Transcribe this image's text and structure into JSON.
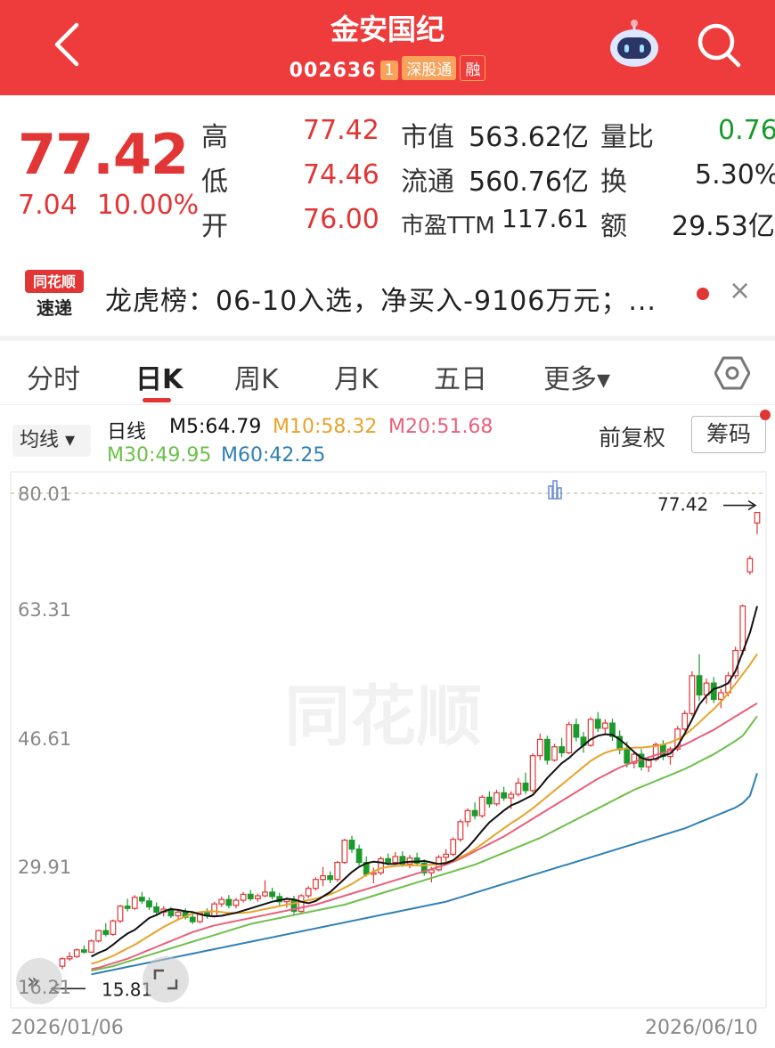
{
  "header": {
    "title": "金安国纪",
    "code": "002636",
    "badge_small": "1",
    "badge_market": "深股通",
    "badge_extra": "融"
  },
  "quote": {
    "price": "77.42",
    "change": "7.04",
    "change_pct": "10.00%",
    "high_label": "高",
    "high_value": "77.42",
    "low_label": "低",
    "low_value": "74.46",
    "open_label": "开",
    "open_value": "76.00",
    "mcap_label": "市值",
    "mcap_value": "563.62亿",
    "float_label": "流通",
    "float_value": "560.76亿",
    "pe_label": "市盈TTM",
    "pe_value": "117.61",
    "volratio_label": "量比",
    "volratio_value": "0.76",
    "turnover_label": "换",
    "turnover_value": "5.30%",
    "amount_label": "额",
    "amount_value": "29.53亿"
  },
  "news": {
    "logo_top": "同花顺",
    "logo_bottom": "速递",
    "text": "龙虎榜：06-10入选，净买入-9106万元；...",
    "close": "×"
  },
  "tabs": [
    "分时",
    "日K",
    "周K",
    "月K",
    "五日",
    "更多▾"
  ],
  "indicators": {
    "button": "均线 ▾",
    "line_label": "日线",
    "ma5": "M5:64.79",
    "ma10": "M10:58.32",
    "ma20": "M20:51.68",
    "ma30": "M30:49.95",
    "ma60": "M60:42.25",
    "adjust": "前复权",
    "chips": "筹码"
  },
  "colors": {
    "red": "#e23535",
    "green": "#1a9a2a",
    "ma5": "#111111",
    "ma10": "#e8a32a",
    "ma20": "#e8607a",
    "ma30": "#6cc04a",
    "ma60": "#2f7fb5"
  },
  "chart_data": {
    "type": "candlestick",
    "y_ticks": [
      "80.01",
      "63.31",
      "46.61",
      "29.91",
      "16.21"
    ],
    "ylim": [
      13.21,
      80.01
    ],
    "x_labels": [
      "2026/01/06",
      "2026/06/10"
    ],
    "annotations": {
      "high": "77.42",
      "low": "15.81"
    },
    "ohlc": [
      [
        16.2,
        17.4,
        15.81,
        17.2
      ],
      [
        17.2,
        18.1,
        16.9,
        17.5
      ],
      [
        17.5,
        18.6,
        17.3,
        18.4
      ],
      [
        18.4,
        19.0,
        17.9,
        18.1
      ],
      [
        18.1,
        19.8,
        18.0,
        19.6
      ],
      [
        19.6,
        21.1,
        19.4,
        21.0
      ],
      [
        21.0,
        22.0,
        20.2,
        20.5
      ],
      [
        20.5,
        22.5,
        20.3,
        22.3
      ],
      [
        22.3,
        24.5,
        22.0,
        24.3
      ],
      [
        24.3,
        25.3,
        23.6,
        24.0
      ],
      [
        24.0,
        25.8,
        23.8,
        25.5
      ],
      [
        25.5,
        26.2,
        24.6,
        25.0
      ],
      [
        25.0,
        25.5,
        23.8,
        24.2
      ],
      [
        24.2,
        24.8,
        23.2,
        23.5
      ],
      [
        23.5,
        24.3,
        22.9,
        23.9
      ],
      [
        23.9,
        24.2,
        22.7,
        23.0
      ],
      [
        23.0,
        23.8,
        22.4,
        23.5
      ],
      [
        23.5,
        24.0,
        22.5,
        22.8
      ],
      [
        22.8,
        23.4,
        21.9,
        22.2
      ],
      [
        22.2,
        23.6,
        22.0,
        23.4
      ],
      [
        23.4,
        24.0,
        22.6,
        23.0
      ],
      [
        23.0,
        24.9,
        22.8,
        24.6
      ],
      [
        24.6,
        25.6,
        24.2,
        25.2
      ],
      [
        25.2,
        25.8,
        24.0,
        24.4
      ],
      [
        24.4,
        25.4,
        24.0,
        25.1
      ],
      [
        25.1,
        26.2,
        24.8,
        25.9
      ],
      [
        25.9,
        26.5,
        25.0,
        25.3
      ],
      [
        25.3,
        26.0,
        24.9,
        25.7
      ],
      [
        25.7,
        27.8,
        25.5,
        26.2
      ],
      [
        26.2,
        26.8,
        25.2,
        25.6
      ],
      [
        25.6,
        26.1,
        24.4,
        24.9
      ],
      [
        24.9,
        25.5,
        24.1,
        25.2
      ],
      [
        25.2,
        25.7,
        23.0,
        23.6
      ],
      [
        23.6,
        25.9,
        23.4,
        25.7
      ],
      [
        25.7,
        27.0,
        25.4,
        26.7
      ],
      [
        26.7,
        28.2,
        26.4,
        27.9
      ],
      [
        27.9,
        29.6,
        27.0,
        28.4
      ],
      [
        28.4,
        29.0,
        27.4,
        27.9
      ],
      [
        27.9,
        30.4,
        27.6,
        30.2
      ],
      [
        30.2,
        33.4,
        30.0,
        33.2
      ],
      [
        33.2,
        33.8,
        31.5,
        32.0
      ],
      [
        32.0,
        32.6,
        29.8,
        30.2
      ],
      [
        30.2,
        31.0,
        28.3,
        28.6
      ],
      [
        28.6,
        29.5,
        27.4,
        28.8
      ],
      [
        28.8,
        31.0,
        28.5,
        30.7
      ],
      [
        30.7,
        31.4,
        29.8,
        30.2
      ],
      [
        30.2,
        31.6,
        29.9,
        31.0
      ],
      [
        31.0,
        31.7,
        29.6,
        30.0
      ],
      [
        30.0,
        31.2,
        29.4,
        30.8
      ],
      [
        30.8,
        31.5,
        29.8,
        30.1
      ],
      [
        30.1,
        30.6,
        28.4,
        28.8
      ],
      [
        28.8,
        29.6,
        27.5,
        29.2
      ],
      [
        29.2,
        31.2,
        29.0,
        30.9
      ],
      [
        30.9,
        32.0,
        30.3,
        31.3
      ],
      [
        31.3,
        33.6,
        31.0,
        33.3
      ],
      [
        33.3,
        36.0,
        33.0,
        35.7
      ],
      [
        35.7,
        37.5,
        35.0,
        37.2
      ],
      [
        37.2,
        38.3,
        36.0,
        36.5
      ],
      [
        36.5,
        39.3,
        36.2,
        39.0
      ],
      [
        39.0,
        39.8,
        37.6,
        38.1
      ],
      [
        38.1,
        40.0,
        37.8,
        39.6
      ],
      [
        39.6,
        40.4,
        38.5,
        38.9
      ],
      [
        38.9,
        39.8,
        37.4,
        39.4
      ],
      [
        39.4,
        41.6,
        39.1,
        40.9
      ],
      [
        40.9,
        42.3,
        39.4,
        39.9
      ],
      [
        39.9,
        44.9,
        39.6,
        44.6
      ],
      [
        44.6,
        47.6,
        44.0,
        46.8
      ],
      [
        46.8,
        47.3,
        43.4,
        44.0
      ],
      [
        44.0,
        46.2,
        43.8,
        45.8
      ],
      [
        45.8,
        47.0,
        44.4,
        45.0
      ],
      [
        45.0,
        49.2,
        44.8,
        48.8
      ],
      [
        48.8,
        49.6,
        46.5,
        47.1
      ],
      [
        47.1,
        47.8,
        45.0,
        46.0
      ],
      [
        46.0,
        49.8,
        45.8,
        49.5
      ],
      [
        49.5,
        50.5,
        47.8,
        48.3
      ],
      [
        48.3,
        49.5,
        47.4,
        49.0
      ],
      [
        49.0,
        49.6,
        46.6,
        47.2
      ],
      [
        47.2,
        48.0,
        44.8,
        45.4
      ],
      [
        45.4,
        46.5,
        43.0,
        43.6
      ],
      [
        43.6,
        45.2,
        42.9,
        44.8
      ],
      [
        44.8,
        45.5,
        42.6,
        43.1
      ],
      [
        43.1,
        44.5,
        42.4,
        44.1
      ],
      [
        44.1,
        46.4,
        43.8,
        46.1
      ],
      [
        46.1,
        46.7,
        44.0,
        44.5
      ],
      [
        44.5,
        45.8,
        43.4,
        45.5
      ],
      [
        45.5,
        48.6,
        45.2,
        48.2
      ],
      [
        48.2,
        50.7,
        47.9,
        50.3
      ],
      [
        50.3,
        56.0,
        50.0,
        55.4
      ],
      [
        55.4,
        58.3,
        52.0,
        52.8
      ],
      [
        52.8,
        55.0,
        51.6,
        54.4
      ],
      [
        54.4,
        55.2,
        51.7,
        52.2
      ],
      [
        52.2,
        53.6,
        51.0,
        53.1
      ],
      [
        53.1,
        55.9,
        52.6,
        55.4
      ],
      [
        55.4,
        59.3,
        55.0,
        58.8
      ],
      [
        58.8,
        65.0,
        58.2,
        64.8
      ],
      [
        69.4,
        71.6,
        69.0,
        71.2
      ],
      [
        76.0,
        77.42,
        74.46,
        77.42
      ]
    ],
    "ma": {
      "M5": [
        17.5,
        18.0,
        18.4,
        19.1,
        19.9,
        20.6,
        21.1,
        21.9,
        22.7,
        23.1,
        23.6,
        23.9,
        23.8,
        23.6,
        23.5,
        23.2,
        23.0,
        22.9,
        23.0,
        23.2,
        23.4,
        23.7,
        24.0,
        24.3,
        24.6,
        24.9,
        25.1,
        25.3,
        25.2,
        24.9,
        24.7,
        25.0,
        25.6,
        26.2,
        27.1,
        28.0,
        28.9,
        29.6,
        30.1,
        30.3,
        30.2,
        30.0,
        30.0,
        30.2,
        30.3,
        30.3,
        30.4,
        30.2,
        30.0,
        30.1,
        30.5,
        31.3,
        32.2,
        33.3,
        34.5,
        35.6,
        36.4,
        37.2,
        37.9,
        38.3,
        38.8,
        39.3,
        40.4,
        41.6,
        42.6,
        43.6,
        44.3,
        45.2,
        46.0,
        46.8,
        47.3,
        47.5,
        47.4,
        46.8,
        46.0,
        45.1,
        44.3,
        44.0,
        44.2,
        44.6,
        44.9,
        45.9,
        47.6,
        49.5,
        51.5,
        52.7,
        53.6,
        53.9,
        54.4,
        56.0,
        58.6,
        61.2,
        64.79
      ],
      "M10": [
        16.5,
        16.8,
        17.2,
        17.6,
        18.1,
        18.6,
        19.1,
        19.7,
        20.3,
        20.9,
        21.5,
        22.0,
        22.5,
        22.9,
        23.3,
        23.5,
        23.6,
        23.6,
        23.5,
        23.4,
        23.4,
        23.4,
        23.5,
        23.7,
        23.9,
        24.1,
        24.3,
        24.5,
        24.7,
        24.9,
        25.1,
        25.3,
        25.6,
        25.9,
        26.3,
        26.8,
        27.3,
        27.9,
        28.5,
        29.0,
        29.4,
        29.6,
        29.7,
        29.8,
        29.8,
        29.8,
        29.8,
        29.9,
        30.0,
        30.2,
        30.5,
        30.9,
        31.4,
        32.0,
        32.7,
        33.4,
        34.1,
        34.8,
        35.5,
        36.1,
        36.8,
        37.5,
        38.3,
        39.1,
        39.9,
        40.7,
        41.5,
        42.3,
        43.1,
        43.9,
        44.5,
        45.0,
        45.3,
        45.5,
        45.6,
        45.7,
        45.7,
        45.8,
        45.9,
        46.1,
        46.4,
        46.8,
        47.4,
        48.2,
        49.1,
        50.0,
        50.9,
        51.9,
        53.0,
        54.3,
        55.6,
        56.9,
        58.32
      ],
      "M20": [
        15.8,
        16.0,
        16.3,
        16.6,
        16.9,
        17.2,
        17.6,
        18.0,
        18.4,
        18.8,
        19.2,
        19.6,
        20.0,
        20.4,
        20.8,
        21.1,
        21.4,
        21.7,
        21.9,
        22.1,
        22.3,
        22.5,
        22.7,
        22.9,
        23.1,
        23.3,
        23.5,
        23.7,
        23.9,
        24.1,
        24.3,
        24.5,
        24.8,
        25.1,
        25.4,
        25.7,
        26.0,
        26.3,
        26.6,
        26.9,
        27.2,
        27.5,
        27.8,
        28.1,
        28.4,
        28.7,
        29.0,
        29.3,
        29.6,
        29.9,
        30.3,
        30.7,
        31.2,
        31.7,
        32.2,
        32.7,
        33.2,
        33.7,
        34.3,
        34.9,
        35.5,
        36.1,
        36.7,
        37.3,
        37.9,
        38.5,
        39.1,
        39.7,
        40.3,
        40.9,
        41.5,
        42.0,
        42.5,
        43.0,
        43.4,
        43.8,
        44.1,
        44.4,
        44.7,
        45.0,
        45.3,
        45.7,
        46.1,
        46.6,
        47.1,
        47.6,
        48.1,
        48.7,
        49.3,
        49.9,
        50.5,
        51.1,
        51.68
      ],
      "M30": [
        15.6,
        15.8,
        16.0,
        16.2,
        16.5,
        16.8,
        17.1,
        17.4,
        17.7,
        18.0,
        18.3,
        18.6,
        18.9,
        19.2,
        19.5,
        19.8,
        20.1,
        20.4,
        20.7,
        21.0,
        21.3,
        21.6,
        21.9,
        22.1,
        22.3,
        22.5,
        22.7,
        22.9,
        23.1,
        23.3,
        23.5,
        23.7,
        23.9,
        24.1,
        24.3,
        24.5,
        24.8,
        25.1,
        25.4,
        25.7,
        26.0,
        26.3,
        26.6,
        26.9,
        27.2,
        27.5,
        27.8,
        28.1,
        28.4,
        28.7,
        29.0,
        29.3,
        29.6,
        29.9,
        30.3,
        30.7,
        31.1,
        31.5,
        31.9,
        32.3,
        32.7,
        33.1,
        33.5,
        34.0,
        34.5,
        35.0,
        35.5,
        36.0,
        36.5,
        37.0,
        37.5,
        38.0,
        38.5,
        39.0,
        39.5,
        40.0,
        40.4,
        40.8,
        41.2,
        41.6,
        42.0,
        42.4,
        42.8,
        43.3,
        43.8,
        44.3,
        44.8,
        45.4,
        46.0,
        46.6,
        47.3,
        48.6,
        49.95
      ],
      "M60": [
        15.1,
        15.3,
        15.5,
        15.7,
        15.9,
        16.1,
        16.3,
        16.5,
        16.7,
        16.9,
        17.1,
        17.3,
        17.5,
        17.7,
        17.9,
        18.1,
        18.3,
        18.5,
        18.7,
        18.9,
        19.1,
        19.3,
        19.5,
        19.7,
        19.9,
        20.1,
        20.3,
        20.5,
        20.7,
        20.9,
        21.1,
        21.3,
        21.5,
        21.7,
        21.9,
        22.1,
        22.3,
        22.5,
        22.7,
        22.9,
        23.1,
        23.3,
        23.5,
        23.7,
        23.9,
        24.1,
        24.3,
        24.5,
        24.7,
        24.9,
        25.2,
        25.5,
        25.8,
        26.1,
        26.4,
        26.7,
        27.0,
        27.3,
        27.6,
        27.9,
        28.2,
        28.5,
        28.8,
        29.1,
        29.4,
        29.7,
        30.0,
        30.3,
        30.6,
        30.9,
        31.2,
        31.5,
        31.8,
        32.1,
        32.4,
        32.7,
        33.0,
        33.3,
        33.6,
        33.9,
        34.2,
        34.5,
        34.8,
        35.2,
        35.6,
        36.0,
        36.4,
        36.8,
        37.2,
        37.6,
        38.2,
        39.2,
        42.25
      ]
    }
  }
}
